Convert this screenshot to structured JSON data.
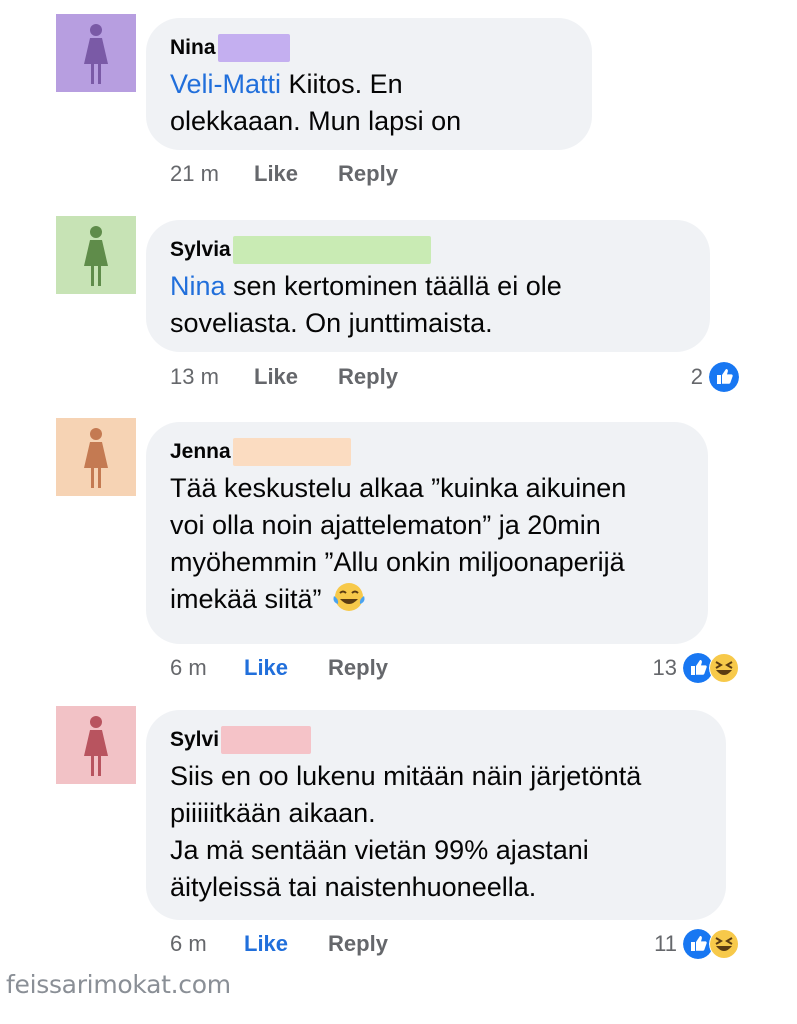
{
  "comments": [
    {
      "name": "Nina",
      "mention": "Veli-Matti",
      "line1_rest": " Kiitos. En",
      "line2": "olekkaaan. Mun lapsi on",
      "time": "21 m",
      "like": "Like",
      "reply": "Reply",
      "avatar_color": "#b79ee0",
      "redact_color": "#c4aff0"
    },
    {
      "name": "Sylvia",
      "mention": "Nina",
      "line1_rest": " sen kertominen täällä ei ole",
      "line2": "soveliasta. On junttimaista.",
      "time": "13 m",
      "like": "Like",
      "reply": "Reply",
      "reaction_count": "2",
      "avatar_color": "#c7e3b5",
      "redact_color": "#c9ebb4"
    },
    {
      "name": "Jenna",
      "line1": "Tää keskustelu alkaa ”kuinka aikuinen",
      "line2": "voi olla noin ajattelematon” ja 20min",
      "line3": "myöhemmin ”Allu onkin miljoonaperijä",
      "line4": "imekää siitä”",
      "time": "6 m",
      "like": "Like",
      "reply": "Reply",
      "reaction_count": "13",
      "avatar_color": "#f6d3b4",
      "redact_color": "#fbdcc1"
    },
    {
      "name": "Sylvi",
      "line1": "Siis en oo lukenu mitään näin järjetöntä",
      "line2": "piiiiitkään aikaan.",
      "line3": "Ja mä sentään vietän 99% ajastani",
      "line4": "äityleissä tai naistenhuoneella.",
      "time": "6 m",
      "like": "Like",
      "reply": "Reply",
      "reaction_count": "11",
      "avatar_color": "#f2c2c6",
      "redact_color": "#f5c3c8"
    }
  ],
  "watermark": "feissarimokat.com",
  "colors": {
    "mention": "#216fdb",
    "like_active": "#216fdb",
    "bubble": "#f0f2f5",
    "meta": "#65676b"
  },
  "icons": [
    "woman-silhouette-icon",
    "thumbs-up-reaction-icon",
    "laughing-reaction-icon",
    "tears-of-joy-emoji"
  ]
}
